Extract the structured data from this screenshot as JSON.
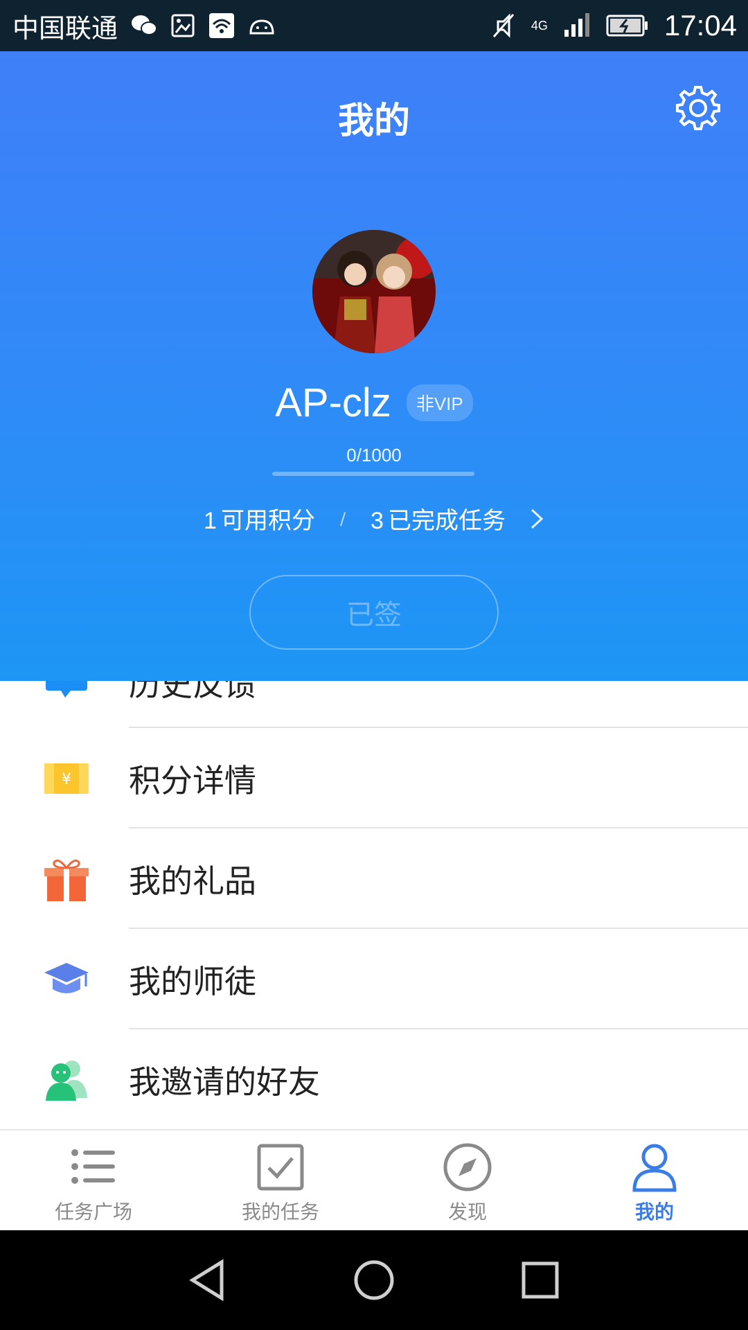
{
  "status_bar": {
    "carrier": "中国联通",
    "network": "4G",
    "time": "17:04"
  },
  "header": {
    "title": "我的",
    "username": "AP-clz",
    "vip_badge": "非VIP",
    "progress_text": "0/1000",
    "progress_fraction": 0.0,
    "points_value": "1",
    "points_label": "可用积分",
    "separator": "/",
    "tasks_value": "3",
    "tasks_label": "已完成任务",
    "sign_button": "已签"
  },
  "menu": {
    "items": [
      {
        "label": "历史反馈",
        "icon": "chat-icon"
      },
      {
        "label": "积分详情",
        "icon": "ticket-icon"
      },
      {
        "label": "我的礼品",
        "icon": "gift-icon"
      },
      {
        "label": "我的师徒",
        "icon": "graduation-cap-icon"
      },
      {
        "label": "我邀请的好友",
        "icon": "friends-icon"
      }
    ]
  },
  "bottom_nav": {
    "items": [
      {
        "label": "任务广场",
        "icon": "list-icon",
        "active": false
      },
      {
        "label": "我的任务",
        "icon": "checkbox-icon",
        "active": false
      },
      {
        "label": "发现",
        "icon": "compass-icon",
        "active": false
      },
      {
        "label": "我的",
        "icon": "person-icon",
        "active": true
      }
    ]
  },
  "colors": {
    "accent": "#3a7de6",
    "header_top": "#3f7ff8",
    "header_bottom": "#1d96f5"
  }
}
